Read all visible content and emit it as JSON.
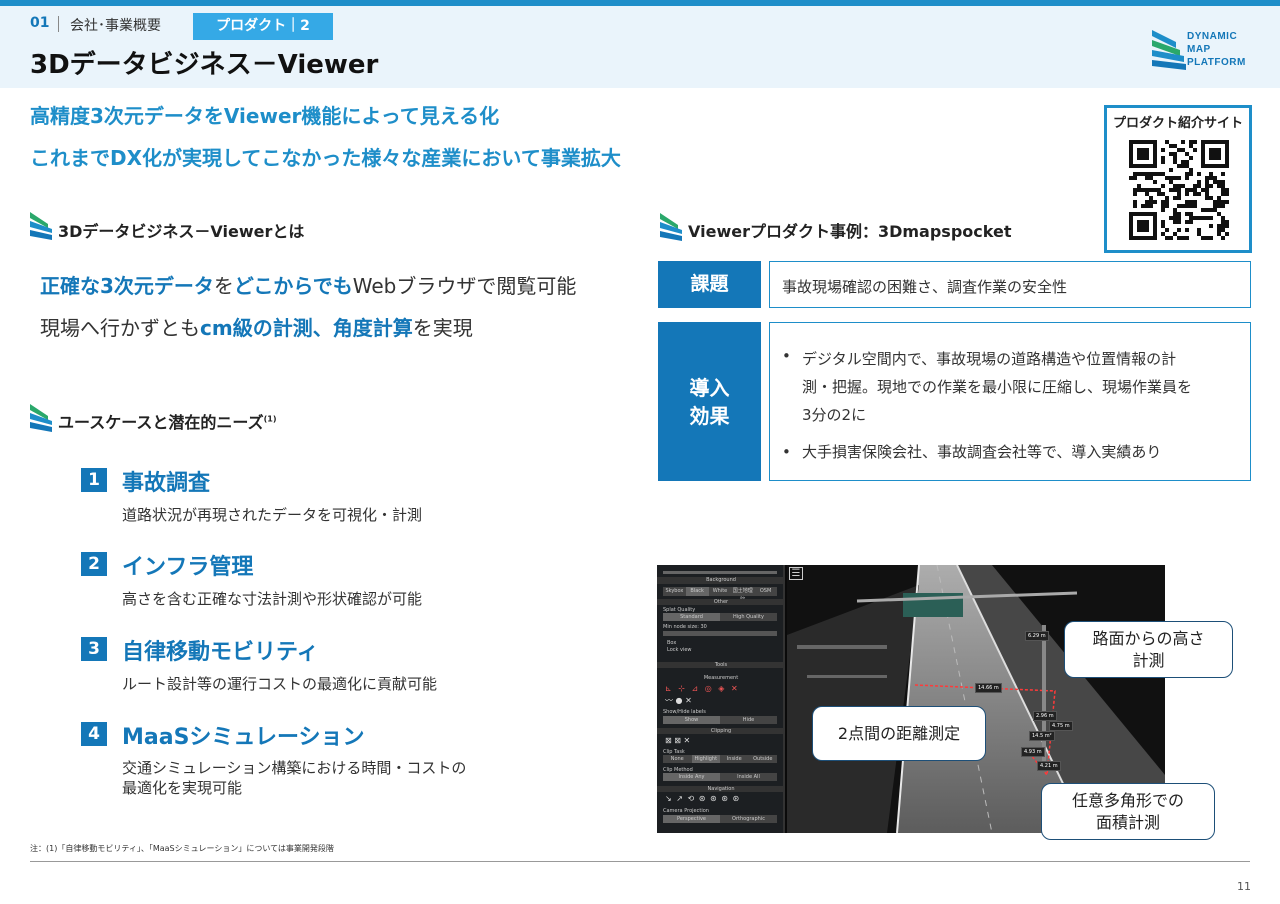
{
  "header": {
    "section_num": "01",
    "section_name": "会社･事業概要",
    "tag": "プロダクト｜2",
    "title": "3Dデータビジネス－Viewer"
  },
  "logo": {
    "line1": "DYNAMIC",
    "line2": "MAP",
    "line3": "PLATFORM"
  },
  "lead": {
    "line1": "高精度3次元データをViewer機能によって見える化",
    "line2": "これまでDX化が実現してこなかった様々な産業において事業拡大"
  },
  "qr": {
    "label": "プロダクト紹介サイト"
  },
  "left": {
    "heading1": "3Dデータビジネス－Viewerとは",
    "line1_b1": "正確な3次元データ",
    "line1_t1": "を",
    "line1_b2": "どこからでも",
    "line1_t2": "Webブラウザで閲覧可能",
    "line2_t1": "現場へ行かずとも",
    "line2_b1": "cm級の計測、角度計算",
    "line2_t2": "を実現",
    "heading2": "ユースケースと潜在的ニーズ",
    "heading2_sup": "(1)",
    "usecases": [
      {
        "num": "1",
        "title": "事故調査",
        "desc": "道路状況が再現されたデータを可視化・計測"
      },
      {
        "num": "2",
        "title": "インフラ管理",
        "desc": "高さを含む正確な寸法計測や形状確認が可能"
      },
      {
        "num": "3",
        "title": "自律移動モビリティ",
        "desc": "ルート設計等の運行コストの最適化に貢献可能"
      },
      {
        "num": "4",
        "title": "MaaSシミュレーション",
        "desc": "交通シミュレーション構築における時間・コストの",
        "desc2": "最適化を実現可能"
      }
    ]
  },
  "right": {
    "heading": "Viewerプロダクト事例：3Dmapspocket",
    "issue_label": "課題",
    "issue_text": "事故現場確認の困難さ、調査作業の安全性",
    "effect_label1": "導入",
    "effect_label2": "効果",
    "effect_b1_l1": "デジタル空間内で、事故現場の道路構造や位置情報の計",
    "effect_b1_l2": "測・把握。現地での作業を最小限に圧縮し、現場作業員を",
    "effect_b1_l3": "3分の2に",
    "effect_b2": "大手損害保険会社、事故調査会社等で、導入実績あり",
    "bullet": "•"
  },
  "screenshot": {
    "callout1_l1": "路面からの高さ",
    "callout1_l2": "計測",
    "callout2": "2点間の距離測定",
    "callout3_l1": "任意多角形での",
    "callout3_l2": "面積計測",
    "panel": {
      "background": "Background",
      "bg_opts": [
        "Skybox",
        "Black",
        "White",
        "国土地理院",
        "OSM"
      ],
      "other": "Other",
      "splat": "Splat Quality",
      "standard": "Standard",
      "high": "High Quality",
      "minnode": "Min node size: 30",
      "box": "Box",
      "lock": "Lock view",
      "tools": "Tools",
      "measurement": "Measurement",
      "showhide": "Show/Hide labels",
      "show": "Show",
      "hide": "Hide",
      "clipping": "Clipping",
      "cliptask": "Clip Task",
      "clip_opts": [
        "None",
        "Highlight",
        "Inside",
        "Outside"
      ],
      "clipmethod": "Clip Method",
      "inside_any": "Inside Any",
      "inside_all": "Inside All",
      "navigation": "Navigation",
      "camproj": "Camera Projection",
      "persp": "Perspective",
      "ortho": "Orthographic"
    },
    "measures": [
      "6.29 m",
      "14.66 m",
      "2.96 m",
      "4.75 m",
      "14.5 m²",
      "4.93 m",
      "4.21 m"
    ]
  },
  "footer": {
    "note": "注：(1)「自律移動モビリティ」、「MaaSシミュレーション」については事業開発段階",
    "page": "11"
  }
}
